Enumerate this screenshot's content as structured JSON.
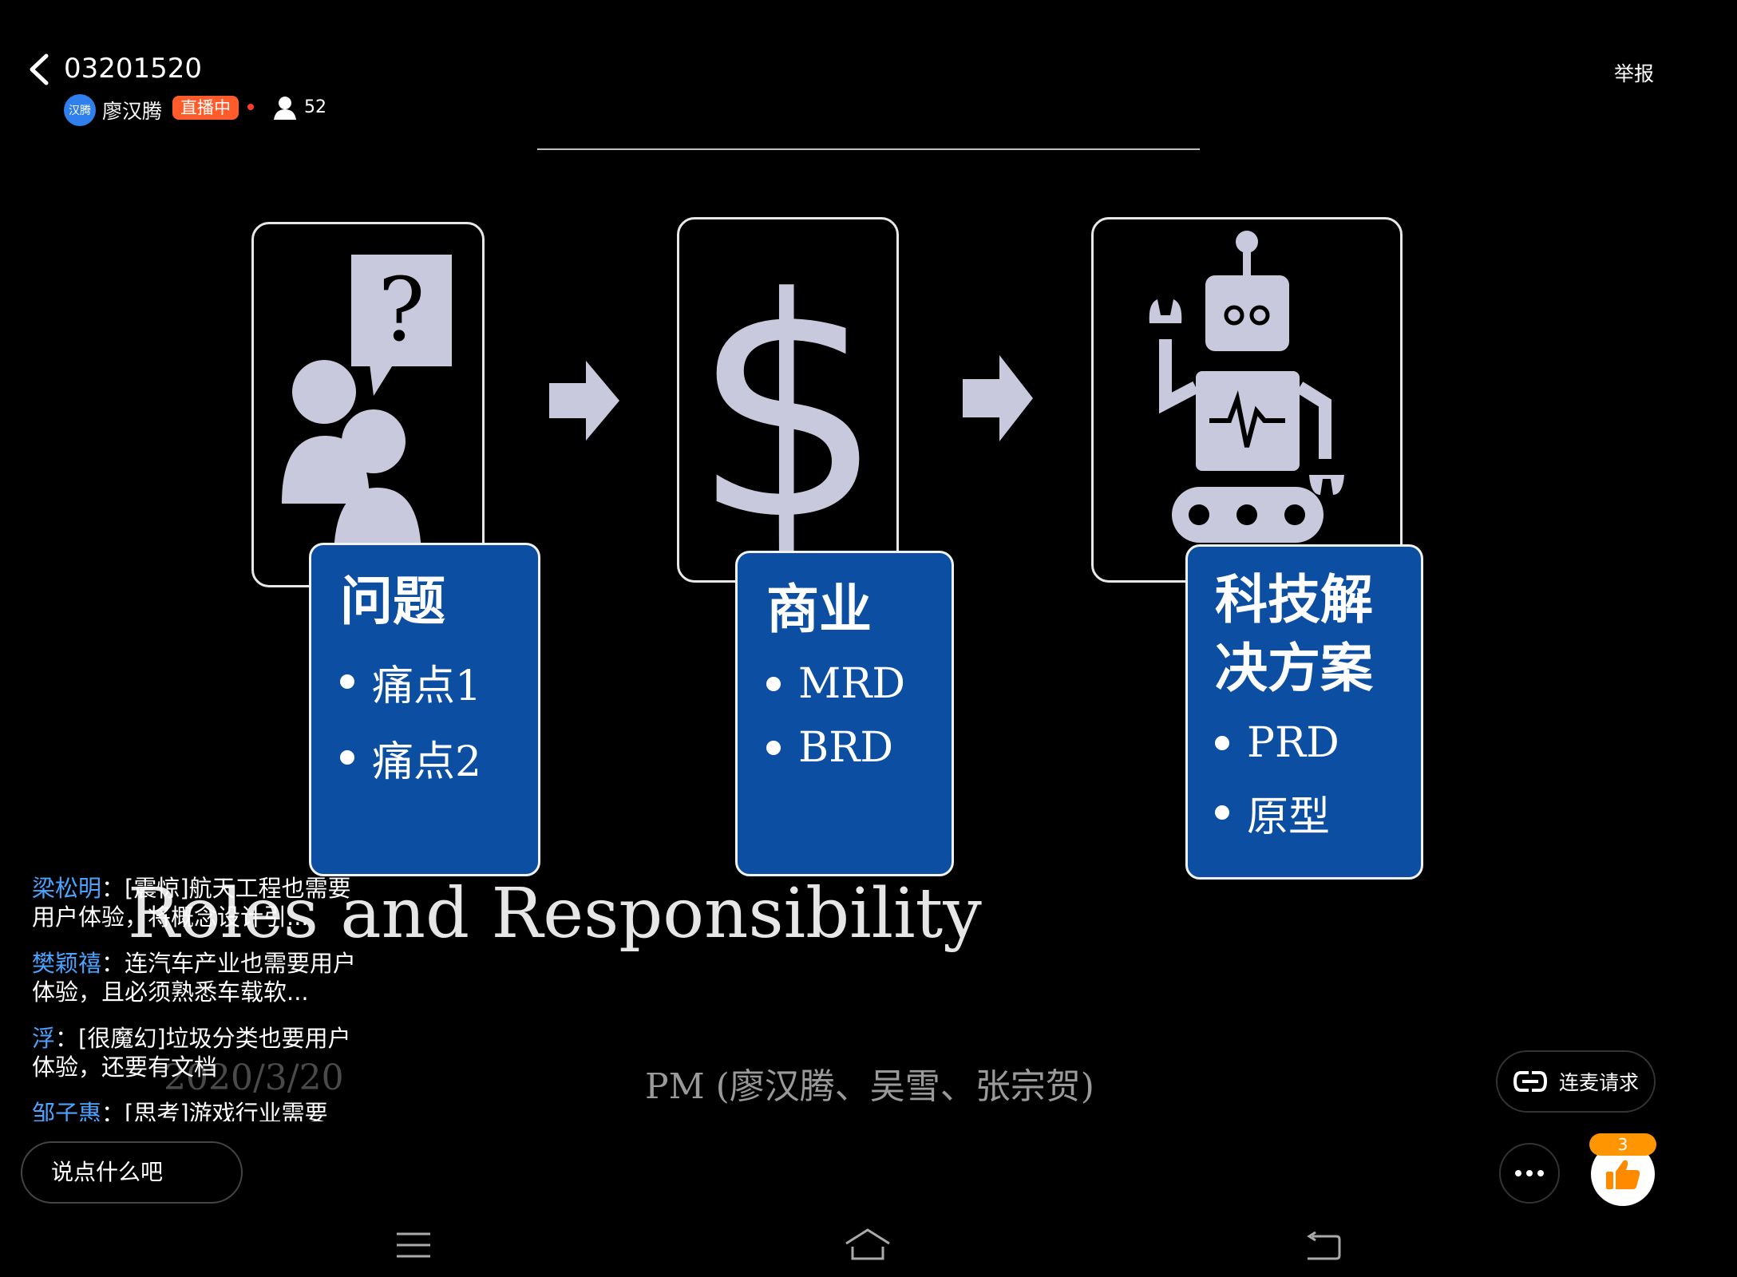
{
  "header": {
    "title": "03201520",
    "avatar_text": "汉腾",
    "host_name": "廖汉腾",
    "live_badge": "直播中",
    "viewer_count": "52",
    "report_label": "举报"
  },
  "slide": {
    "boxes": [
      {
        "title": "问题",
        "items": [
          "痛点1",
          "痛点2"
        ]
      },
      {
        "title": "商业",
        "items": [
          "MRD",
          "BRD"
        ]
      },
      {
        "title": "科技解决方案",
        "title_line1": "科技解",
        "title_line2": "决方案",
        "items": [
          "PRD",
          "原型"
        ]
      }
    ],
    "subtitle": "Roles and Responsibility",
    "date": "2020/3/20",
    "authors": "PM (廖汉腾、吴雪、张宗贺)"
  },
  "comments": [
    {
      "user": "梁松明",
      "sep": "：",
      "text": "[震惊]航天工程也需要用户体验，将概念设计引..."
    },
    {
      "user": "樊颖禧",
      "sep": "：",
      "text": "连汽车产业也需要用户体验，且必须熟悉车载软..."
    },
    {
      "user": "浮",
      "sep": "：",
      "text": "[很魔幻]垃圾分类也要用户体验，还要有文档"
    },
    {
      "user": "邹子惠",
      "sep": "：",
      "text": "[思考]游戏行业需要"
    }
  ],
  "controls": {
    "input_placeholder": "说点什么吧",
    "mic_request_label": "连麦请求",
    "like_count": "3"
  },
  "colors": {
    "box_blue": "#0b4ea2",
    "live_orange": "#ff5b2b",
    "like_orange": "#ff9500",
    "username_blue": "#4aa3ff"
  }
}
